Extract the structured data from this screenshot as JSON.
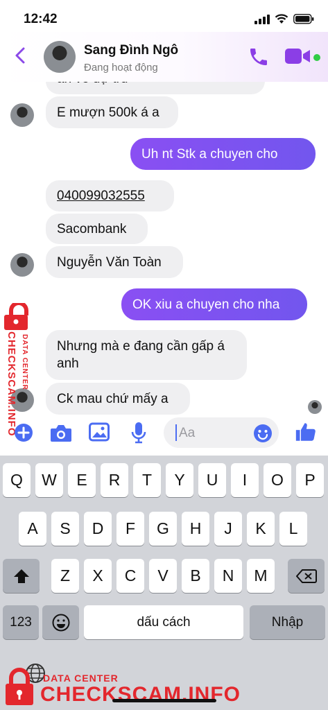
{
  "status_bar": {
    "time": "12:42"
  },
  "header": {
    "contact_name": "Sang Đình Ngô",
    "contact_status": "Đang hoạt động"
  },
  "messages": [
    {
      "side": "in",
      "text": "an ve dự tru"
    },
    {
      "side": "in",
      "text": "E mượn 500k á a"
    },
    {
      "side": "out",
      "text": "Uh nt Stk a chuyen cho"
    },
    {
      "side": "in",
      "text": "040099032555"
    },
    {
      "side": "in",
      "text": "Sacombank"
    },
    {
      "side": "in",
      "text": "Nguyễn Văn Toàn"
    },
    {
      "side": "out",
      "text": "OK xiu a chuyen cho nha"
    },
    {
      "side": "in",
      "text": "Nhưng mà e đang cần gấp á anh"
    },
    {
      "side": "in",
      "text": "Ck mau chứ mấy a"
    }
  ],
  "composer": {
    "placeholder": "Aa"
  },
  "keyboard": {
    "row1": [
      "Q",
      "W",
      "E",
      "R",
      "T",
      "Y",
      "U",
      "I",
      "O",
      "P"
    ],
    "row2": [
      "A",
      "S",
      "D",
      "F",
      "G",
      "H",
      "J",
      "K",
      "L"
    ],
    "row3": [
      "Z",
      "X",
      "C",
      "V",
      "B",
      "N",
      "M"
    ],
    "numbers_label": "123",
    "space_label": "dấu cách",
    "return_label": "Nhập"
  },
  "watermark": {
    "side_main": "CHECKSCAM.INFO",
    "side_small": "DATA CENTER",
    "bottom_small": "DATA CENTER",
    "bottom_main": "CHECKSCAM.INFO"
  },
  "colors": {
    "accent": "#8a4ff3",
    "online": "#31cc46",
    "watermark": "#e3272d"
  }
}
